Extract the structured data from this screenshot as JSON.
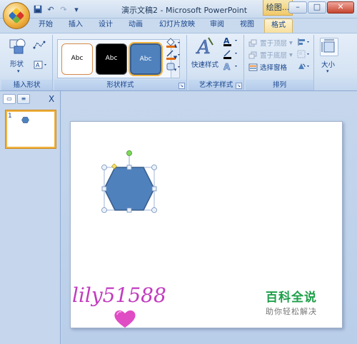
{
  "window": {
    "title": "演示文稿2 - Microsoft PowerPoint",
    "context_tab_group": "绘图...",
    "minimize": "–",
    "maximize": "□",
    "close": "✕"
  },
  "quick_access": {
    "save": "save-icon",
    "undo": "↶",
    "redo": "↷",
    "customize": "▾"
  },
  "tabs": [
    {
      "label": "开始"
    },
    {
      "label": "插入"
    },
    {
      "label": "设计"
    },
    {
      "label": "动画"
    },
    {
      "label": "幻灯片放映"
    },
    {
      "label": "审阅"
    },
    {
      "label": "视图"
    },
    {
      "label": "格式",
      "active": true
    }
  ],
  "ribbon": {
    "insert_shapes": {
      "label": "插入形状",
      "shapes_label": "形状",
      "arrow": "▾"
    },
    "shape_styles": {
      "label": "形状样式",
      "swatches": [
        "Abc",
        "Abc",
        "Abc"
      ]
    },
    "wordart": {
      "label": "艺术字样式",
      "quick_styles": "快速样式"
    },
    "arrange": {
      "label": "排列",
      "bring_front": "置于顶层",
      "send_back": "置于底层",
      "selection_pane": "选择窗格"
    },
    "size": {
      "label": "大小"
    }
  },
  "side_panel": {
    "slide_number": "1",
    "close": "X"
  },
  "watermarks": {
    "left": "lily51588",
    "right_title": "百科全说",
    "right_subtitle": "助你轻松解决"
  },
  "colors": {
    "accent": "#f0b341",
    "shape_fill": "#4f81bd",
    "shape_outline": "#385d8a"
  }
}
